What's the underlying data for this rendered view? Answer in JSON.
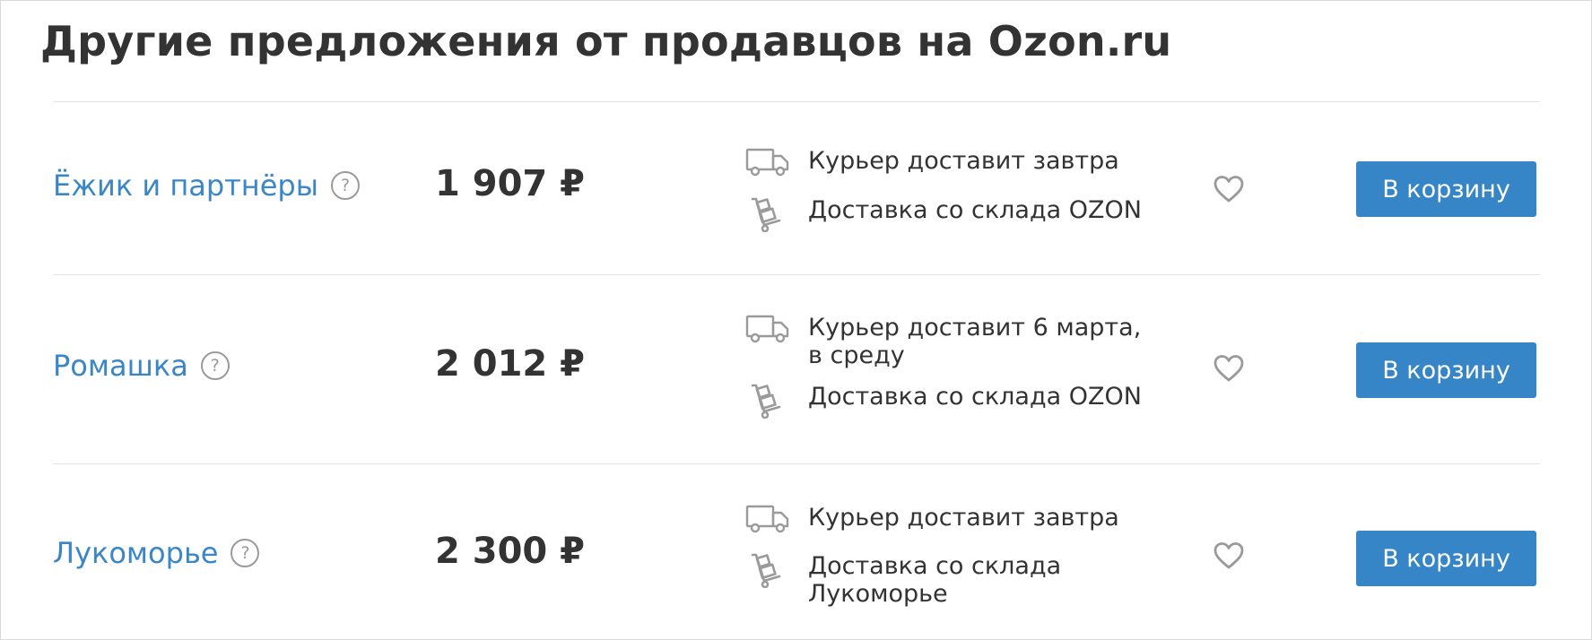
{
  "title": "Другие предложения от продавцов на Ozon.ru",
  "help_glyph": "?",
  "offers": [
    {
      "seller": "Ёжик и партнёры",
      "price": "1 907 ₽",
      "courier": "Курьер доставит завтра",
      "warehouse": "Доставка со склада OZON",
      "button": "В корзину"
    },
    {
      "seller": "Ромашка",
      "price": "2 012 ₽",
      "courier": "Курьер доставит 6 марта, в среду",
      "warehouse": "Доставка со склада OZON",
      "button": "В корзину"
    },
    {
      "seller": "Лукоморье",
      "price": "2 300 ₽",
      "courier": "Курьер доставит завтра",
      "warehouse": "Доставка со склада Лукоморье",
      "button": "В корзину"
    }
  ],
  "icons": {
    "courier": "truck-icon",
    "warehouse": "hand-truck-icon",
    "favorite": "heart-icon",
    "help": "question-circle-icon"
  },
  "colors": {
    "link": "#3b86c6",
    "button": "#3585c7",
    "icon": "#9a9a9a",
    "text": "#333333",
    "divider": "#e3e3e3"
  }
}
